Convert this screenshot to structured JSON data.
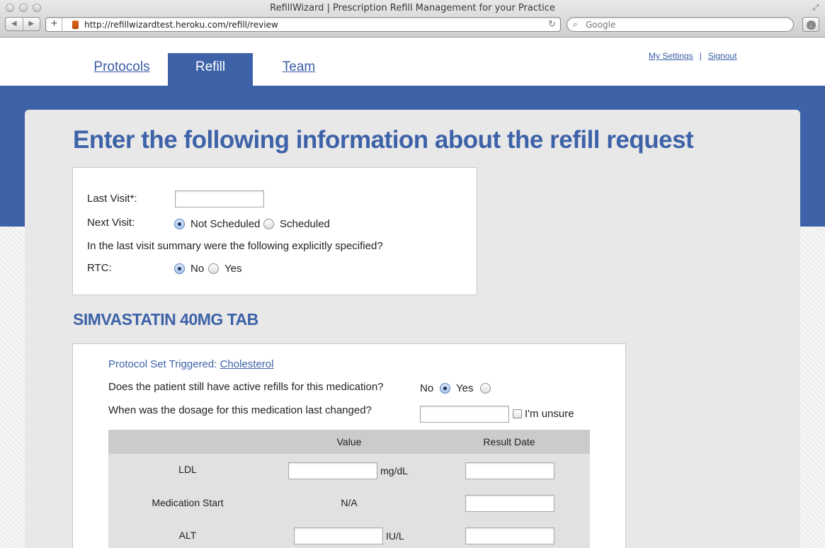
{
  "browser": {
    "window_title": "RefillWizard | Prescription Refill Management for your Practice",
    "url": "http://refillwizardtest.heroku.com/refill/review",
    "search_placeholder": "Google",
    "back_glyph": "◀",
    "forward_glyph": "▶",
    "add_glyph": "+",
    "reload_glyph": "↻",
    "search_glyph": "⌕",
    "download_glyph": "↓",
    "fullscreen_glyph": "⤢"
  },
  "nav": {
    "tabs": [
      {
        "label": "Protocols",
        "active": false
      },
      {
        "label": "Refill",
        "active": true
      },
      {
        "label": "Team",
        "active": false
      }
    ],
    "user_links": {
      "settings": "My Settings",
      "separator": "|",
      "signout": "Signout"
    }
  },
  "page": {
    "title": "Enter the following information about the refill request"
  },
  "visit_form": {
    "last_visit_label": "Last Visit*:",
    "last_visit_value": "",
    "next_visit_label": "Next Visit:",
    "next_visit_options": [
      {
        "label": "Not Scheduled",
        "selected": true
      },
      {
        "label": "Scheduled",
        "selected": false
      }
    ],
    "summary_question": "In the last visit summary were the following explicitly specified?",
    "rtc_label": "RTC:",
    "rtc_options": [
      {
        "label": "No",
        "selected": true
      },
      {
        "label": "Yes",
        "selected": false
      }
    ]
  },
  "medication": {
    "name": "SIMVASTATIN 40MG TAB",
    "protocol_prefix": "Protocol Set Triggered:",
    "protocol_link": "Cholesterol",
    "active_refills_question": "Does the patient still have active refills for this medication?",
    "active_refills_options": [
      {
        "label": "No",
        "selected": true
      },
      {
        "label": "Yes",
        "selected": false
      }
    ],
    "dosage_question": "When was the dosage for this medication last changed?",
    "dosage_value": "",
    "unsure_label": "I'm unsure",
    "unsure_checked": false
  },
  "lab_table": {
    "headers": {
      "value": "Value",
      "result_date": "Result Date"
    },
    "rows": [
      {
        "label": "LDL",
        "value": "",
        "unit": "mg/dL",
        "result_date": ""
      },
      {
        "label": "Medication Start",
        "value_text": "N/A",
        "result_date": ""
      },
      {
        "label": "ALT",
        "value": "",
        "unit": "IU/L",
        "result_date": ""
      }
    ]
  },
  "colors": {
    "brand_blue": "#3d62a8",
    "panel_gray": "#e8e8e8",
    "table_header": "#cbcbcb"
  }
}
